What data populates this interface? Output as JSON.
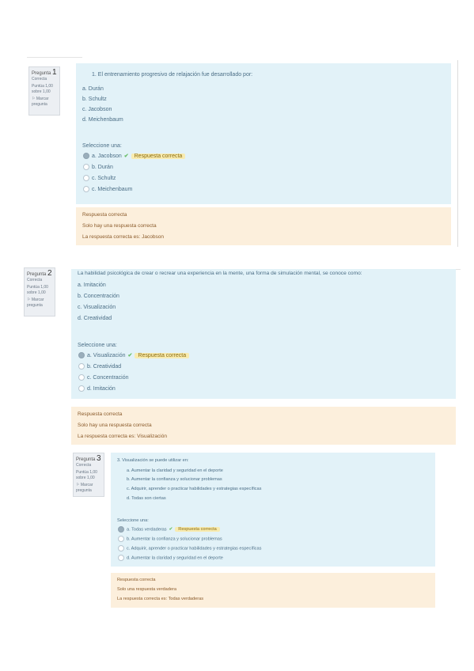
{
  "questions": [
    {
      "number_label": "Pregunta",
      "number": "1",
      "status": "Correcta",
      "mark": "Puntúa 1,00 sobre 1,00",
      "flag": "Marcar pregunta",
      "text": "1. El entrenamiento progresivo de relajación fue desarrollado por:",
      "options": [
        "a. Durán",
        "b. Schultz",
        "c. Jacobson",
        "d. Meichenbaum"
      ],
      "select_label": "Seleccione una:",
      "answers": [
        {
          "label": "a. Jacobson",
          "selected": true,
          "correct": true
        },
        {
          "label": "b. Durán",
          "selected": false
        },
        {
          "label": "c. Schultz",
          "selected": false
        },
        {
          "label": "c. Meichenbaum",
          "selected": false
        }
      ],
      "badge": "Respuesta correcta",
      "feedback_title": "Respuesta correcta",
      "feedback_note": "Solo hay una respuesta correcta",
      "feedback_answer": "La respuesta correcta es: Jacobson"
    },
    {
      "number_label": "Pregunta",
      "number": "2",
      "status": "Correcta",
      "mark": "Puntúa 1,00 sobre 1,00",
      "flag": "Marcar pregunta",
      "text": "La habilidad psicológica de crear o recrear una experiencia en la mente, una forma de simulación mental, se conoce como:",
      "options": [
        "a. Imitación",
        "b. Concentración",
        "c. Visualización",
        "d. Creatividad"
      ],
      "select_label": "Seleccione una:",
      "answers": [
        {
          "label": "a. Visualización",
          "selected": true,
          "correct": true
        },
        {
          "label": "b. Creatividad",
          "selected": false
        },
        {
          "label": "c. Concentración",
          "selected": false
        },
        {
          "label": "d. Imitación",
          "selected": false
        }
      ],
      "badge": "Respuesta correcta",
      "feedback_title": "Respuesta correcta",
      "feedback_note": "Solo hay una respuesta correcta",
      "feedback_answer": "La respuesta correcta es: Visualización"
    },
    {
      "number_label": "Pregunta",
      "number": "3",
      "status": "Correcta",
      "mark": "Puntúa 1,00 sobre 1,00",
      "flag": "Marcar pregunta",
      "text": "3. Visualización se puede utilizar en:",
      "options": [
        "a. Aumentar la claridad y seguridad en el deporte",
        "b. Aumentar la confianza y solucionar problemas",
        "c. Adquirir, aprender o practicar habilidades y estrategias específicas",
        "d. Todas son ciertas"
      ],
      "select_label": "Seleccione una:",
      "answers": [
        {
          "label": "a. Todas verdaderas",
          "selected": true,
          "correct": true
        },
        {
          "label": "b. Aumentar la confianza y solucionar problemas",
          "selected": false
        },
        {
          "label": "c. Adquirir, aprender o practicar habilidades y estrategias específicas",
          "selected": false
        },
        {
          "label": "d. Aumentar la claridad y seguridad en el deporte",
          "selected": false
        }
      ],
      "badge": "Respuesta correcta",
      "feedback_title": "Respuesta correcta",
      "feedback_note": "Solo una respuesta verdadera",
      "feedback_answer": "La respuesta correcta es: Todas verdaderas"
    }
  ]
}
